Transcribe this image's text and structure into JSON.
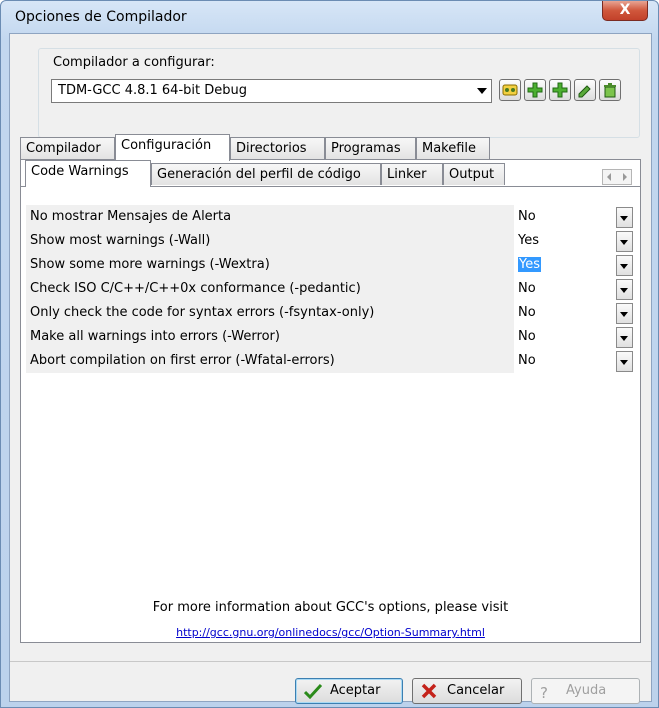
{
  "window": {
    "title": "Opciones de Compilador",
    "close_label": "X"
  },
  "compiler_group": {
    "label": "Compilador a configurar:",
    "selected": "TDM-GCC 4.8.1 64-bit Debug",
    "tool_icons": [
      "copy-settings-icon",
      "add-compiler-icon",
      "add-compiler-alt-icon",
      "rename-icon",
      "delete-icon"
    ]
  },
  "main_tabs": [
    "Compilador",
    "Configuración",
    "Directorios",
    "Programas",
    "Makefile"
  ],
  "main_tab_active": "Configuración",
  "sub_tabs": [
    "Code Warnings",
    "Generación del perfil de código",
    "Linker",
    "Output"
  ],
  "sub_tab_active": "Code Warnings",
  "options": [
    {
      "label": "No mostrar Mensajes de Alerta",
      "value": "No"
    },
    {
      "label": "Show most warnings (-Wall)",
      "value": "Yes"
    },
    {
      "label": "Show some more warnings (-Wextra)",
      "value": "Yes"
    },
    {
      "label": "Check ISO C/C++/C++0x conformance (-pedantic)",
      "value": "No"
    },
    {
      "label": "Only check the code for syntax errors (-fsyntax-only)",
      "value": "No"
    },
    {
      "label": "Make all warnings into errors (-Werror)",
      "value": "No"
    },
    {
      "label": "Abort compilation on first error (-Wfatal-errors)",
      "value": "No"
    }
  ],
  "info_text": "For more information about GCC's options, please visit",
  "info_link": "http://gcc.gnu.org/onlinedocs/gcc/Option-Summary.html",
  "buttons": {
    "ok": "Aceptar",
    "cancel": "Cancelar",
    "help": "Ayuda"
  },
  "colors": {
    "selection": "#3399ff",
    "link": "#0000cc"
  }
}
